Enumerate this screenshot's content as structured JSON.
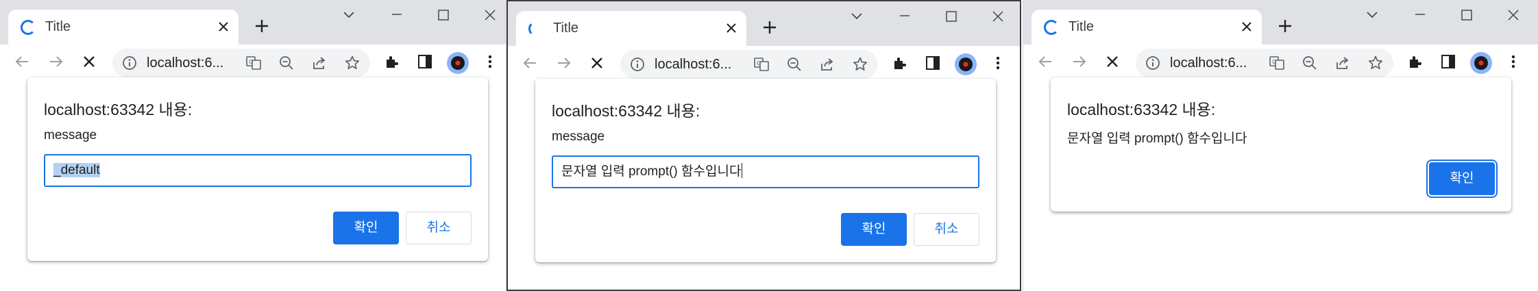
{
  "windows": [
    {
      "tab": {
        "title": "Title"
      },
      "omnibox": {
        "url": "localhost:6..."
      },
      "dialog": {
        "title": "localhost:63342 내용:",
        "message": "message",
        "input_value": "_default",
        "ok_label": "확인",
        "cancel_label": "취소"
      }
    },
    {
      "tab": {
        "title": "Title"
      },
      "omnibox": {
        "url": "localhost:6..."
      },
      "dialog": {
        "title": "localhost:63342 내용:",
        "message": "message",
        "input_value": "문자열 입력 prompt() 함수입니다",
        "ok_label": "확인",
        "cancel_label": "취소"
      }
    },
    {
      "tab": {
        "title": "Title"
      },
      "omnibox": {
        "url": "localhost:6..."
      },
      "dialog": {
        "title": "localhost:63342 내용:",
        "message": "문자열 입력 prompt() 함수입니다",
        "ok_label": "확인"
      }
    }
  ],
  "colors": {
    "accent": "#1a73e8",
    "tabstrip": "#dfe1e5",
    "omnibox": "#f1f3f4"
  },
  "icons": [
    "loading-spinner-icon",
    "close-icon",
    "plus-icon",
    "chevron-down-icon",
    "minimize-icon",
    "maximize-icon",
    "back-arrow-icon",
    "forward-arrow-icon",
    "stop-icon",
    "info-icon",
    "translate-icon",
    "zoom-out-icon",
    "share-icon",
    "star-icon",
    "extensions-icon",
    "side-panel-icon",
    "profile-avatar",
    "more-vert-icon"
  ]
}
